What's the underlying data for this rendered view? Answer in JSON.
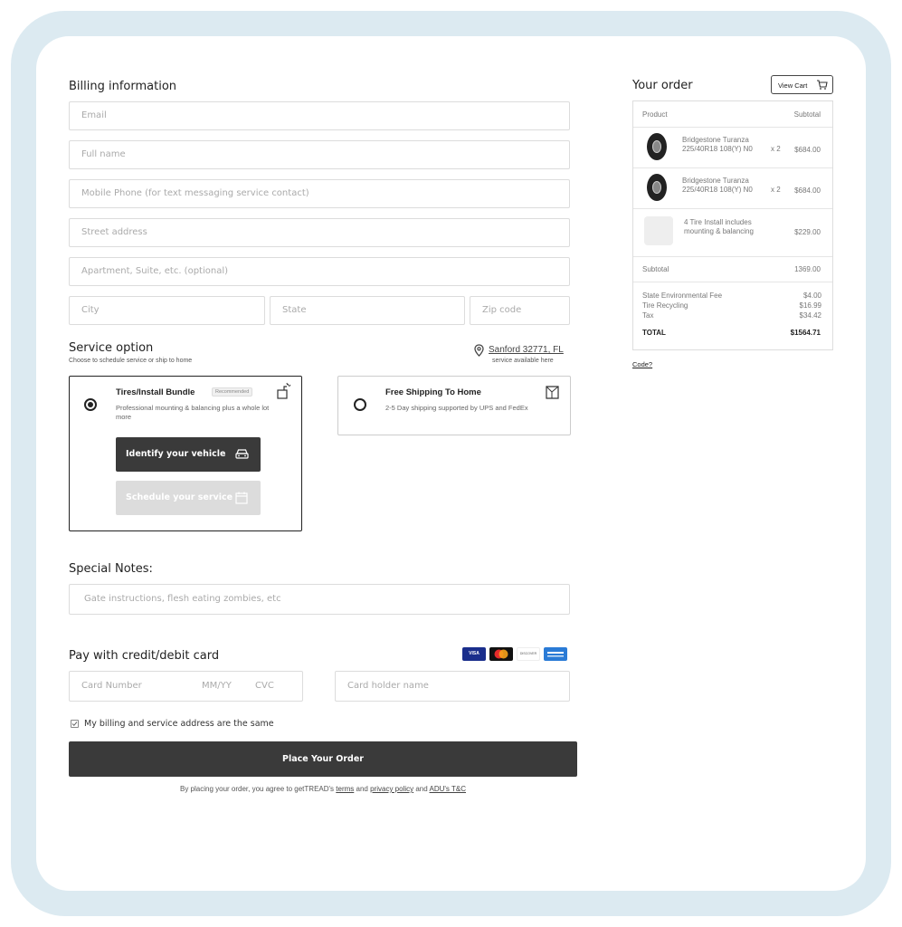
{
  "billing": {
    "title": "Billing information",
    "email_placeholder": "Email",
    "fullname_placeholder": "Full name",
    "phone_placeholder": "Mobile Phone (for text messaging service contact)",
    "street_placeholder": "Street address",
    "apt_placeholder": "Apartment, Suite, etc. (optional)",
    "city_placeholder": "City",
    "state_placeholder": "State",
    "zip_placeholder": "Zip code"
  },
  "service": {
    "title": "Service option",
    "subtitle": "Choose to schedule service or ship to home",
    "location_link": "Sanford 32771, FL",
    "location_note": "service available here",
    "option1": {
      "title": "Tires/Install Bundle",
      "badge": "Recommended",
      "desc": "Professional mounting & balancing plus a whole lot more",
      "identify_button": "Identify your vehicle",
      "schedule_button": "Schedule your service"
    },
    "option2": {
      "title": "Free Shipping To Home",
      "desc": "2-5 Day shipping supported by UPS and FedEx"
    }
  },
  "notes": {
    "title": "Special Notes:",
    "placeholder": "Gate instructions, flesh eating zombies, etc"
  },
  "payment": {
    "title": "Pay with credit/debit card",
    "card_number_placeholder": "Card Number",
    "expiry_placeholder": "MM/YY",
    "cvc_placeholder": "CVC",
    "holder_placeholder": "Card holder name",
    "cards": [
      "VISA",
      "MASTERCARD",
      "DISCOVER",
      "AMEX"
    ],
    "same_address_label": "My billing and service address are the same",
    "place_order": "Place Your Order",
    "legal_prefix": "By placing  your order, you agree to getTREAD's",
    "terms": "terms",
    "and1": "and",
    "privacy": "privacy policy",
    "and2": "and",
    "adu": "ADU's T&C"
  },
  "order": {
    "title": "Your order",
    "view_cart": "View Cart",
    "col_product": "Product",
    "col_subtotal": "Subtotal",
    "items": [
      {
        "name": "Bridgestone Turanza 225/40R18 108(Y) N0",
        "qty": "x 2",
        "price": "$684.00"
      },
      {
        "name": "Bridgestone Turanza 225/40R18 108(Y) N0",
        "qty": "x 2",
        "price": "$684.00"
      },
      {
        "name": "4 Tire Install includes mounting & balancing",
        "qty": "",
        "price": "$229.00"
      }
    ],
    "subtotal_label": "Subtotal",
    "subtotal_value": "1369.00",
    "fees": [
      {
        "label": "State Environmental Fee",
        "value": "$4.00"
      },
      {
        "label": "Tire Recycling",
        "value": "$16.99"
      },
      {
        "label": "Tax",
        "value": "$34.42"
      }
    ],
    "total_label": "TOTAL",
    "total_value": "$1564.71",
    "code_link": "Code?"
  }
}
